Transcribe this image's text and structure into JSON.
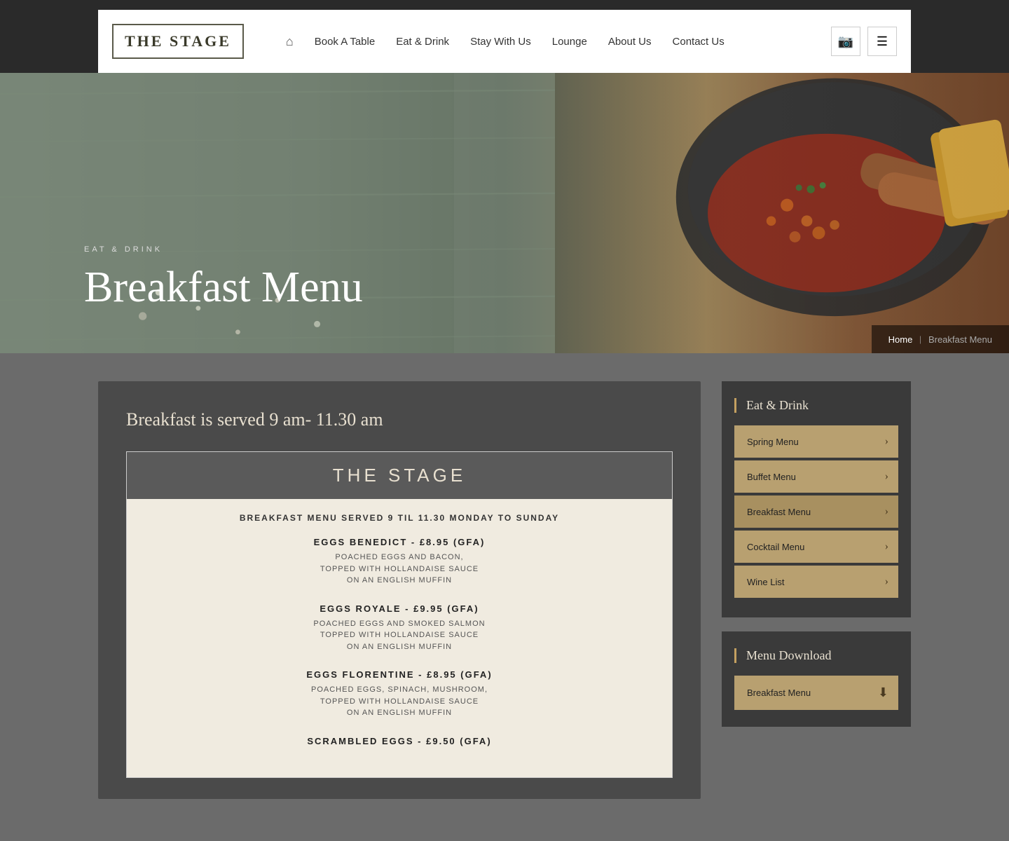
{
  "topBar": {},
  "header": {
    "logo": {
      "text": "THE STAGE"
    },
    "nav": {
      "homeIcon": "⌂",
      "items": [
        {
          "label": "Book A Table",
          "id": "book-a-table"
        },
        {
          "label": "Eat & Drink",
          "id": "eat-and-drink"
        },
        {
          "label": "Stay With Us",
          "id": "stay-with-us"
        },
        {
          "label": "Lounge",
          "id": "lounge"
        },
        {
          "label": "About Us",
          "id": "about-us"
        },
        {
          "label": "Contact Us",
          "id": "contact-us"
        }
      ]
    },
    "cameraIcon": "📷",
    "menuIcon": "☰"
  },
  "banner": {
    "subtitle": "EAT & DRINK",
    "title": "Breakfast Menu",
    "breadcrumb": {
      "home": "Home",
      "separator": "|",
      "current": "Breakfast Menu"
    }
  },
  "main": {
    "servedText": "Breakfast is served 9 am- 11.30 am",
    "menuCard": {
      "title": "THE STAGE",
      "subtitle": "BREAKFAST MENU SERVED 9 TIL 11.30 MONDAY TO SUNDAY",
      "items": [
        {
          "name": "EGGS BENEDICT - £8.95 (GFA)",
          "desc": "POACHED EGGS AND BACON,\nTOPPED WITH HOLLANDAISE SAUCE\nON AN ENGLISH MUFFIN"
        },
        {
          "name": "EGGS ROYALE - £9.95 (GFA)",
          "desc": "POACHED EGGS AND SMOKED SALMON\nTOPPED WITH HOLLANDAISE SAUCE\nON AN ENGLISH MUFFIN"
        },
        {
          "name": "EGGS FLORENTINE - £8.95 (GFA)",
          "desc": "POACHED EGGS, SPINACH, MUSHROOM,\nTOPPED WITH HOLLANDAISE SAUCE\nON AN ENGLISH MUFFIN"
        },
        {
          "name": "SCRAMBLED EGGS - £9.50 (GFA)",
          "desc": ""
        }
      ]
    }
  },
  "sidebar": {
    "eatDrink": {
      "title": "Eat & Drink",
      "items": [
        {
          "label": "Spring Menu",
          "id": "spring-menu"
        },
        {
          "label": "Buffet Menu",
          "id": "buffet-menu"
        },
        {
          "label": "Breakfast Menu",
          "id": "breakfast-menu",
          "active": true
        },
        {
          "label": "Cocktail Menu",
          "id": "cocktail-menu"
        },
        {
          "label": "Wine List",
          "id": "wine-list"
        }
      ],
      "arrow": "›"
    },
    "menuDownload": {
      "title": "Menu Download",
      "items": [
        {
          "label": "Breakfast Menu",
          "id": "breakfast-menu-download"
        }
      ],
      "downloadIcon": "⬇"
    }
  }
}
